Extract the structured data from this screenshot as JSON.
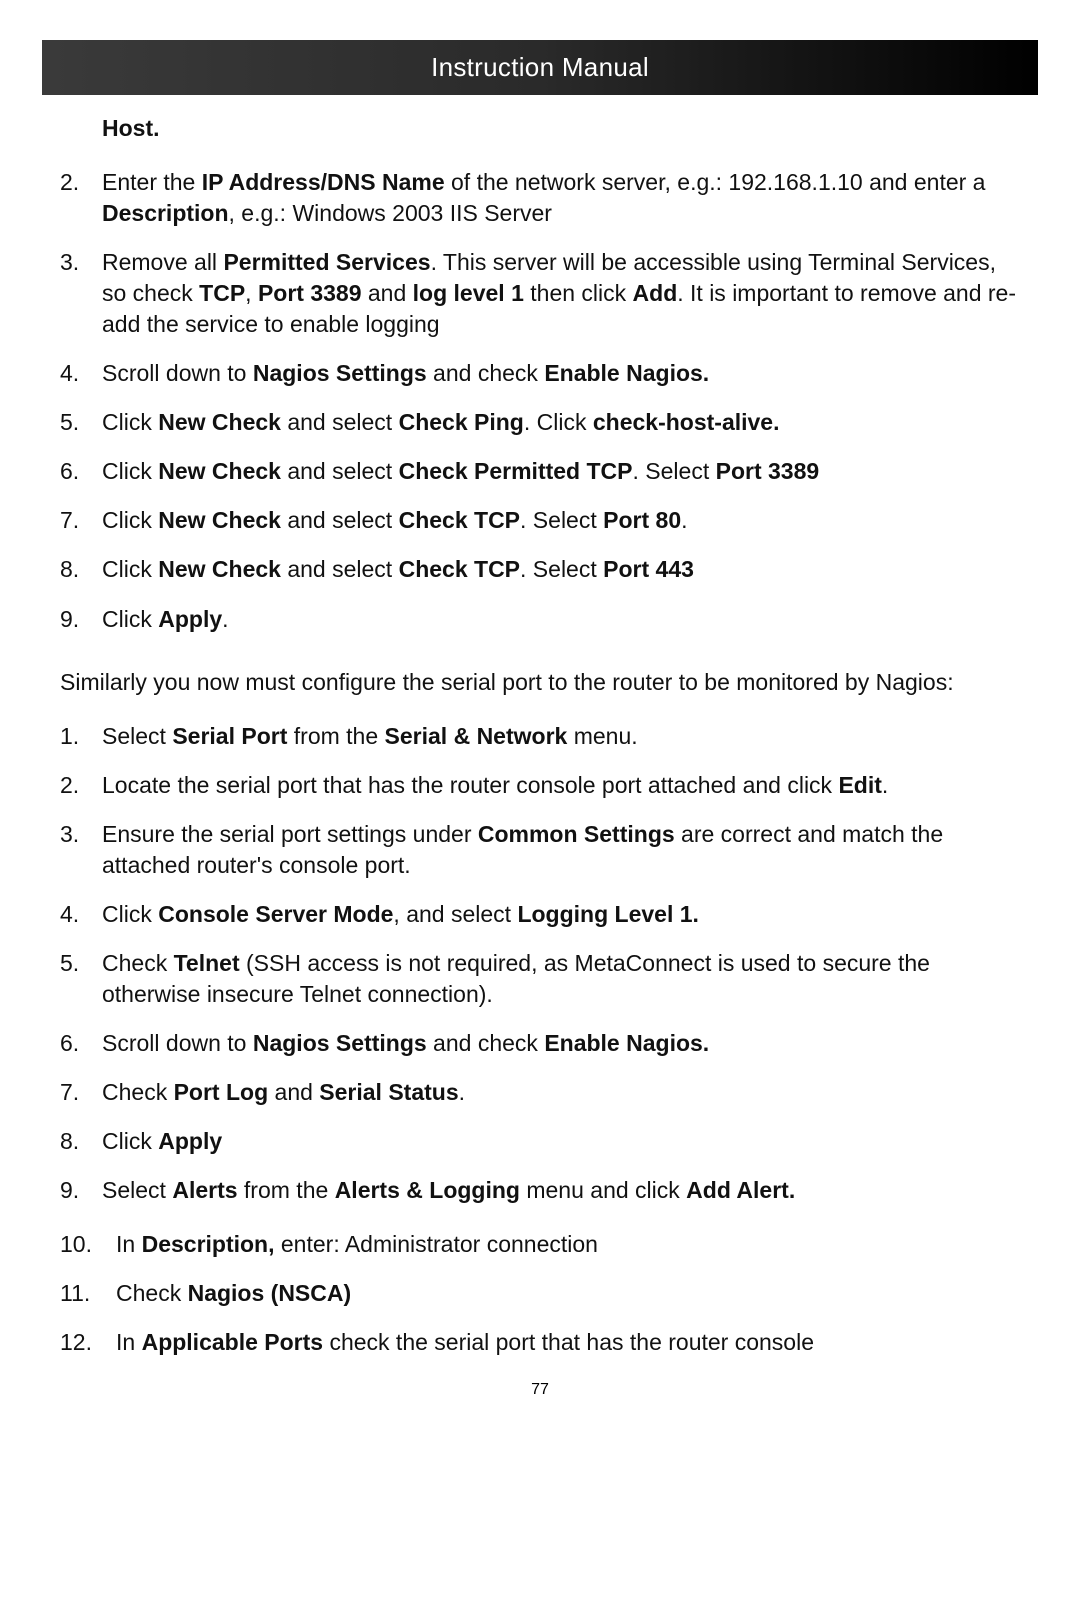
{
  "header": {
    "title": "Instruction Manual"
  },
  "intro_bold": "Host",
  "intro_period": ".",
  "list1": {
    "start": 1,
    "items": [
      {
        "runs": [
          [
            "Enter the ",
            0
          ],
          [
            "IP Address/DNS Name",
            1
          ],
          [
            " of the network server, e.g.: 192.168.1.10 and enter a ",
            0
          ],
          [
            "Description",
            1
          ],
          [
            ", e.g.: Windows 2003 IIS Server",
            0
          ]
        ]
      },
      {
        "runs": [
          [
            "Remove all ",
            0
          ],
          [
            "Permitted Services",
            1
          ],
          [
            ".  This server will be accessible using Terminal Services, so check ",
            0
          ],
          [
            "TCP",
            1
          ],
          [
            ", ",
            0
          ],
          [
            "Port 3389",
            1
          ],
          [
            " and ",
            0
          ],
          [
            "log level 1",
            1
          ],
          [
            " then click ",
            0
          ],
          [
            "Add",
            1
          ],
          [
            ". It is important to remove and re-add the service to enable logging",
            0
          ]
        ]
      },
      {
        "runs": [
          [
            "Scroll down to ",
            0
          ],
          [
            "Nagios Settings",
            1
          ],
          [
            " and check ",
            0
          ],
          [
            "Enable Nagios.",
            1
          ]
        ]
      },
      {
        "runs": [
          [
            "Click ",
            0
          ],
          [
            "New Check",
            1
          ],
          [
            " and select ",
            0
          ],
          [
            "Check Ping",
            1
          ],
          [
            ". Click ",
            0
          ],
          [
            "check-host-alive.",
            1
          ]
        ]
      },
      {
        "runs": [
          [
            "Click ",
            0
          ],
          [
            "New Check",
            1
          ],
          [
            " and select ",
            0
          ],
          [
            "Check Permitted TCP",
            1
          ],
          [
            ". Select ",
            0
          ],
          [
            "Port 3389",
            1
          ]
        ]
      },
      {
        "runs": [
          [
            "Click ",
            0
          ],
          [
            "New Check",
            1
          ],
          [
            " and select ",
            0
          ],
          [
            "Check TCP",
            1
          ],
          [
            ". Select ",
            0
          ],
          [
            "Port 80",
            1
          ],
          [
            ".",
            0
          ]
        ]
      },
      {
        "runs": [
          [
            "Click ",
            0
          ],
          [
            "New Check",
            1
          ],
          [
            " and select ",
            0
          ],
          [
            "Check TCP",
            1
          ],
          [
            ". Select ",
            0
          ],
          [
            "Port 443",
            1
          ]
        ]
      },
      {
        "runs": [
          [
            "Click ",
            0
          ],
          [
            "Apply",
            1
          ],
          [
            ".",
            0
          ]
        ]
      }
    ]
  },
  "paragraph": "Similarly you now must configure the serial port to the router to be monitored by Nagios:",
  "list2": {
    "start": 0,
    "items": [
      {
        "runs": [
          [
            "Select ",
            0
          ],
          [
            "Serial Port",
            1
          ],
          [
            " from the ",
            0
          ],
          [
            "Serial & Network",
            1
          ],
          [
            " menu.",
            0
          ]
        ]
      },
      {
        "runs": [
          [
            "Locate the serial port that has the router console port attached and click ",
            0
          ],
          [
            "Edit",
            1
          ],
          [
            ".",
            0
          ]
        ]
      },
      {
        "runs": [
          [
            "Ensure the serial port settings under ",
            0
          ],
          [
            "Common Settings",
            1
          ],
          [
            " are correct and match the attached router's console port.",
            0
          ]
        ]
      },
      {
        "runs": [
          [
            "Click ",
            0
          ],
          [
            "Console Server Mode",
            1
          ],
          [
            ", and select ",
            0
          ],
          [
            "Logging Level 1.",
            1
          ]
        ]
      },
      {
        "runs": [
          [
            "Check ",
            0
          ],
          [
            "Telnet",
            1
          ],
          [
            " (SSH access is not required, as MetaConnect is used to secure the otherwise insecure Telnet connection).",
            0
          ]
        ]
      },
      {
        "runs": [
          [
            "Scroll down to ",
            0
          ],
          [
            "Nagios Settings",
            1
          ],
          [
            " and check ",
            0
          ],
          [
            "Enable Nagios.",
            1
          ]
        ]
      },
      {
        "runs": [
          [
            "Check ",
            0
          ],
          [
            "Port Log",
            1
          ],
          [
            " and ",
            0
          ],
          [
            "Serial Status",
            1
          ],
          [
            ".",
            0
          ]
        ]
      },
      {
        "runs": [
          [
            "Click ",
            0
          ],
          [
            "Apply",
            1
          ]
        ]
      },
      {
        "runs": [
          [
            "Select ",
            0
          ],
          [
            "Alerts",
            1
          ],
          [
            " from the ",
            0
          ],
          [
            "Alerts & Logging",
            1
          ],
          [
            " menu and click ",
            0
          ],
          [
            "Add Alert.",
            1
          ]
        ]
      }
    ]
  },
  "list3": {
    "start": 9,
    "items": [
      {
        "runs": [
          [
            "In ",
            0
          ],
          [
            "Description,",
            1
          ],
          [
            " enter: Administrator connection",
            0
          ]
        ]
      },
      {
        "runs": [
          [
            "Check ",
            0
          ],
          [
            "Nagios (NSCA)",
            1
          ]
        ]
      },
      {
        "runs": [
          [
            "In ",
            0
          ],
          [
            "Applicable Ports",
            1
          ],
          [
            " check the serial port that has the router console",
            0
          ]
        ]
      }
    ]
  },
  "page_number": "77"
}
